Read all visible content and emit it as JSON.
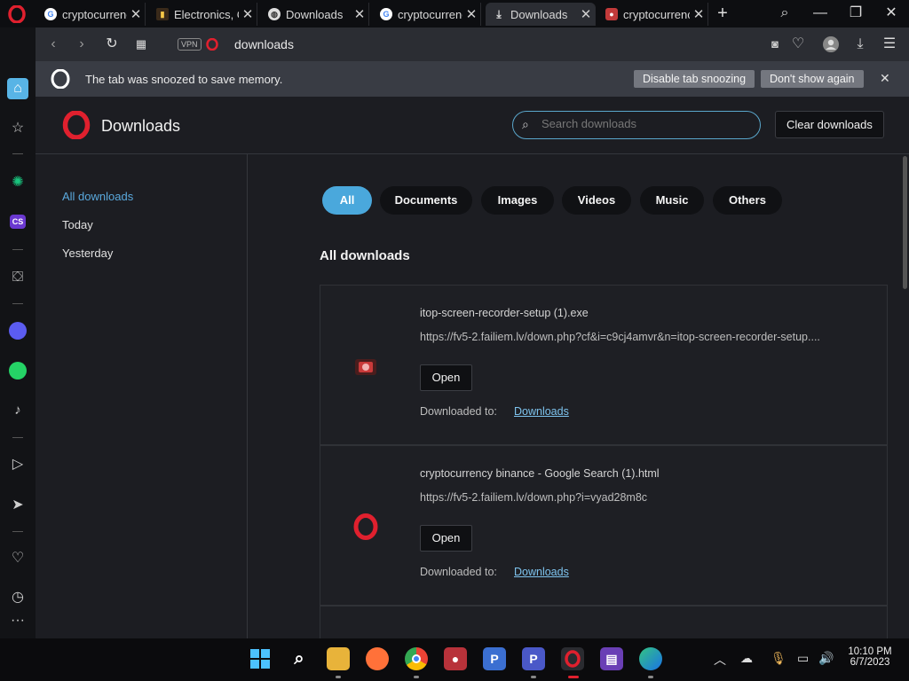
{
  "tabs": [
    {
      "label": "cryptocurrenc",
      "favicon": "google-icon",
      "active": false
    },
    {
      "label": "Electronics, C",
      "favicon": "store-icon",
      "active": false
    },
    {
      "label": "Downloads",
      "favicon": "globe-icon",
      "active": false
    },
    {
      "label": "cryptocurrenc",
      "favicon": "google-icon",
      "active": false
    },
    {
      "label": "Downloads",
      "favicon": "download-icon",
      "active": true
    },
    {
      "label": "cryptocurrenc",
      "favicon": "itop-icon",
      "active": false
    }
  ],
  "addressbar": {
    "url": "downloads",
    "vpn": "VPN"
  },
  "snooze": {
    "message": "The tab was snoozed to save memory.",
    "disable_label": "Disable tab snoozing",
    "dont_show_label": "Don't show again"
  },
  "page": {
    "title": "Downloads",
    "search_placeholder": "Search downloads",
    "clear_label": "Clear downloads"
  },
  "nav": {
    "items": [
      {
        "label": "All downloads",
        "active": true
      },
      {
        "label": "Today",
        "active": false
      },
      {
        "label": "Yesterday",
        "active": false
      }
    ]
  },
  "filters": [
    "All",
    "Documents",
    "Images",
    "Videos",
    "Music",
    "Others"
  ],
  "section_title": "All downloads",
  "downloads": [
    {
      "filename": "itop-screen-recorder-setup (1).exe",
      "url": "https://fv5-2.failiem.lv/down.php?cf&i=c9cj4amvr&n=itop-screen-recorder-setup....",
      "open_label": "Open",
      "downloaded_to_label": "Downloaded to:",
      "location": "Downloads",
      "icon": "itop-icon"
    },
    {
      "filename": "cryptocurrency binance - Google Search (1).html",
      "url": "https://fv5-2.failiem.lv/down.php?i=vyad28m8c",
      "open_label": "Open",
      "downloaded_to_label": "Downloaded to:",
      "location": "Downloads",
      "icon": "opera-icon"
    }
  ],
  "taskbar": {
    "time": "10:10 PM",
    "date": "6/7/2023"
  },
  "colors": {
    "accent": "#4aa8dc",
    "opera_red": "#e0202e",
    "background": "#1c1d22"
  }
}
